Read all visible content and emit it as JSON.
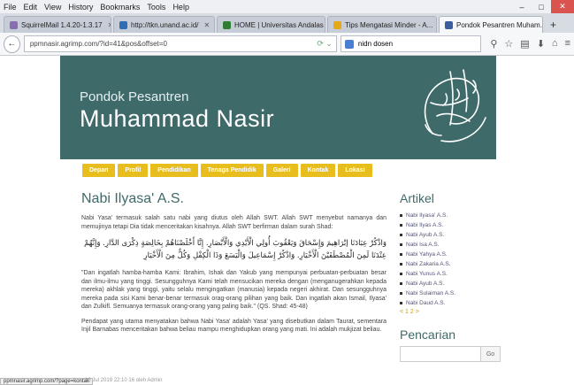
{
  "browser": {
    "menu": [
      "File",
      "Edit",
      "View",
      "History",
      "Bookmarks",
      "Tools",
      "Help"
    ],
    "tabs": [
      {
        "label": "SquirrelMail 1.4.20-1.3.17",
        "color": "#8a6fb0",
        "active": false
      },
      {
        "label": "http://tkn.unand.ac.id/",
        "color": "#2f6db5",
        "active": false
      },
      {
        "label": "HOME | Universitas Andalas",
        "color": "#2e7d32",
        "active": false
      },
      {
        "label": "Tips Mengatasi Minder - A...",
        "color": "#e6a817",
        "active": false
      },
      {
        "label": "Pondok Pesantren Muham...",
        "color": "#3b5f9e",
        "active": true
      }
    ],
    "url": "ppmnasir.agrimp.com/?id=41&pos&offset=0",
    "search_value": "nidn dosen",
    "window_controls": [
      "–",
      "□",
      "✕"
    ]
  },
  "site": {
    "subtitle": "Pondok Pesantren",
    "title": "Muhammad Nasir",
    "nav": [
      "Depan",
      "Profil",
      "Pendidikan",
      "Tenaga Pendidik",
      "Galeri",
      "Kontak",
      "Lokasi"
    ],
    "accent": "#e8be1e",
    "header_color": "#3f6a6a"
  },
  "article": {
    "title": "Nabi Ilyasa' A.S.",
    "p1": "Nabi Yasa' termasuk salah satu nabi yang diutus oleh Allah SWT. Allah SWT menyebut namanya dan memujinya tetapi Dia tidak menceritakan kisahnya. Allah SWT berfirman dalam surah Shad:",
    "arabic": "وَاذْكُرْ عِبَادَنَا إبْرَاهِيمَ وَإِسْحَاقَ وَيَعْقُوبَ أُولِي الْأَيْدِي وَالْأَبْصَارِ. إِنَّا أَخْلَصْنَاهُمْ بِخَالِصَةٍ ذِكْرَى الدَّارِ. وَإِنَّهُمْ عِنْدَنَا لَمِنَ الْمُصْطَفَيْنَ الْأَخْيَارِ. وَاذْكُرْ إِسْمَاعِيلَ وَالْيَسَعَ وَذَا الْكِفْلِ وَكُلٌّ مِنَ الْأَخْيَارِ",
    "p2": "\"Dan ingatlah hamba-hamba Kami: Ibrahim, Ishak dan Yakub yang mempunyai perbuatan-perbuatan besar dan ilmu-ilmu yang tinggi. Sesungguhnya Kami telah mensucikan mereka dengan (menganugerahkan kepada mereka) akhlak yang tinggi, yaitu selalu mengingatkan (manusia) kepada negeri akhirat. Dan sesungguhnya mereka pada sisi Kami benar-benar termasuk orag-orang pilihan yang baik. Dan ingatlah akan Ismail, Ilyasa' dan Zulkifl. Semuanya termasuk orang-orang yang paling baik.\" (QS. Shad: 45-48)",
    "p3": "Pendapat yang utama menyatakan bahwa Nabi Yasa' adalah Yasa' yang disebutkan dalam Taurat, sementara Injil Barnabas menceritakan bahwa beliau mampu menghidupkan orang yang mati. Ini adalah mukjizat beliau."
  },
  "sidebar": {
    "artikel_title": "Artikel",
    "items": [
      "Nabi Ilyasa' A.S.",
      "Nabi Ilyas A.S.",
      "Nabi Ayub A.S.",
      "Nabi Isa A.S.",
      "Nabi Yahya A.S.",
      "Nabi Zakaria A.S.",
      "Nabi Yunus A.S.",
      "Nabi Ayub A.S.",
      "Nabi Sulaiman A.S.",
      "Nabi Daud A.S."
    ],
    "pagination": "< 1 2 >",
    "search_title": "Pencarian",
    "search_button": "Go"
  },
  "status": {
    "link": "ppmnasir.agrimp.com/?page=kontak",
    "meta": "16 Jul 2019 22:10 16 oleh Admin"
  }
}
